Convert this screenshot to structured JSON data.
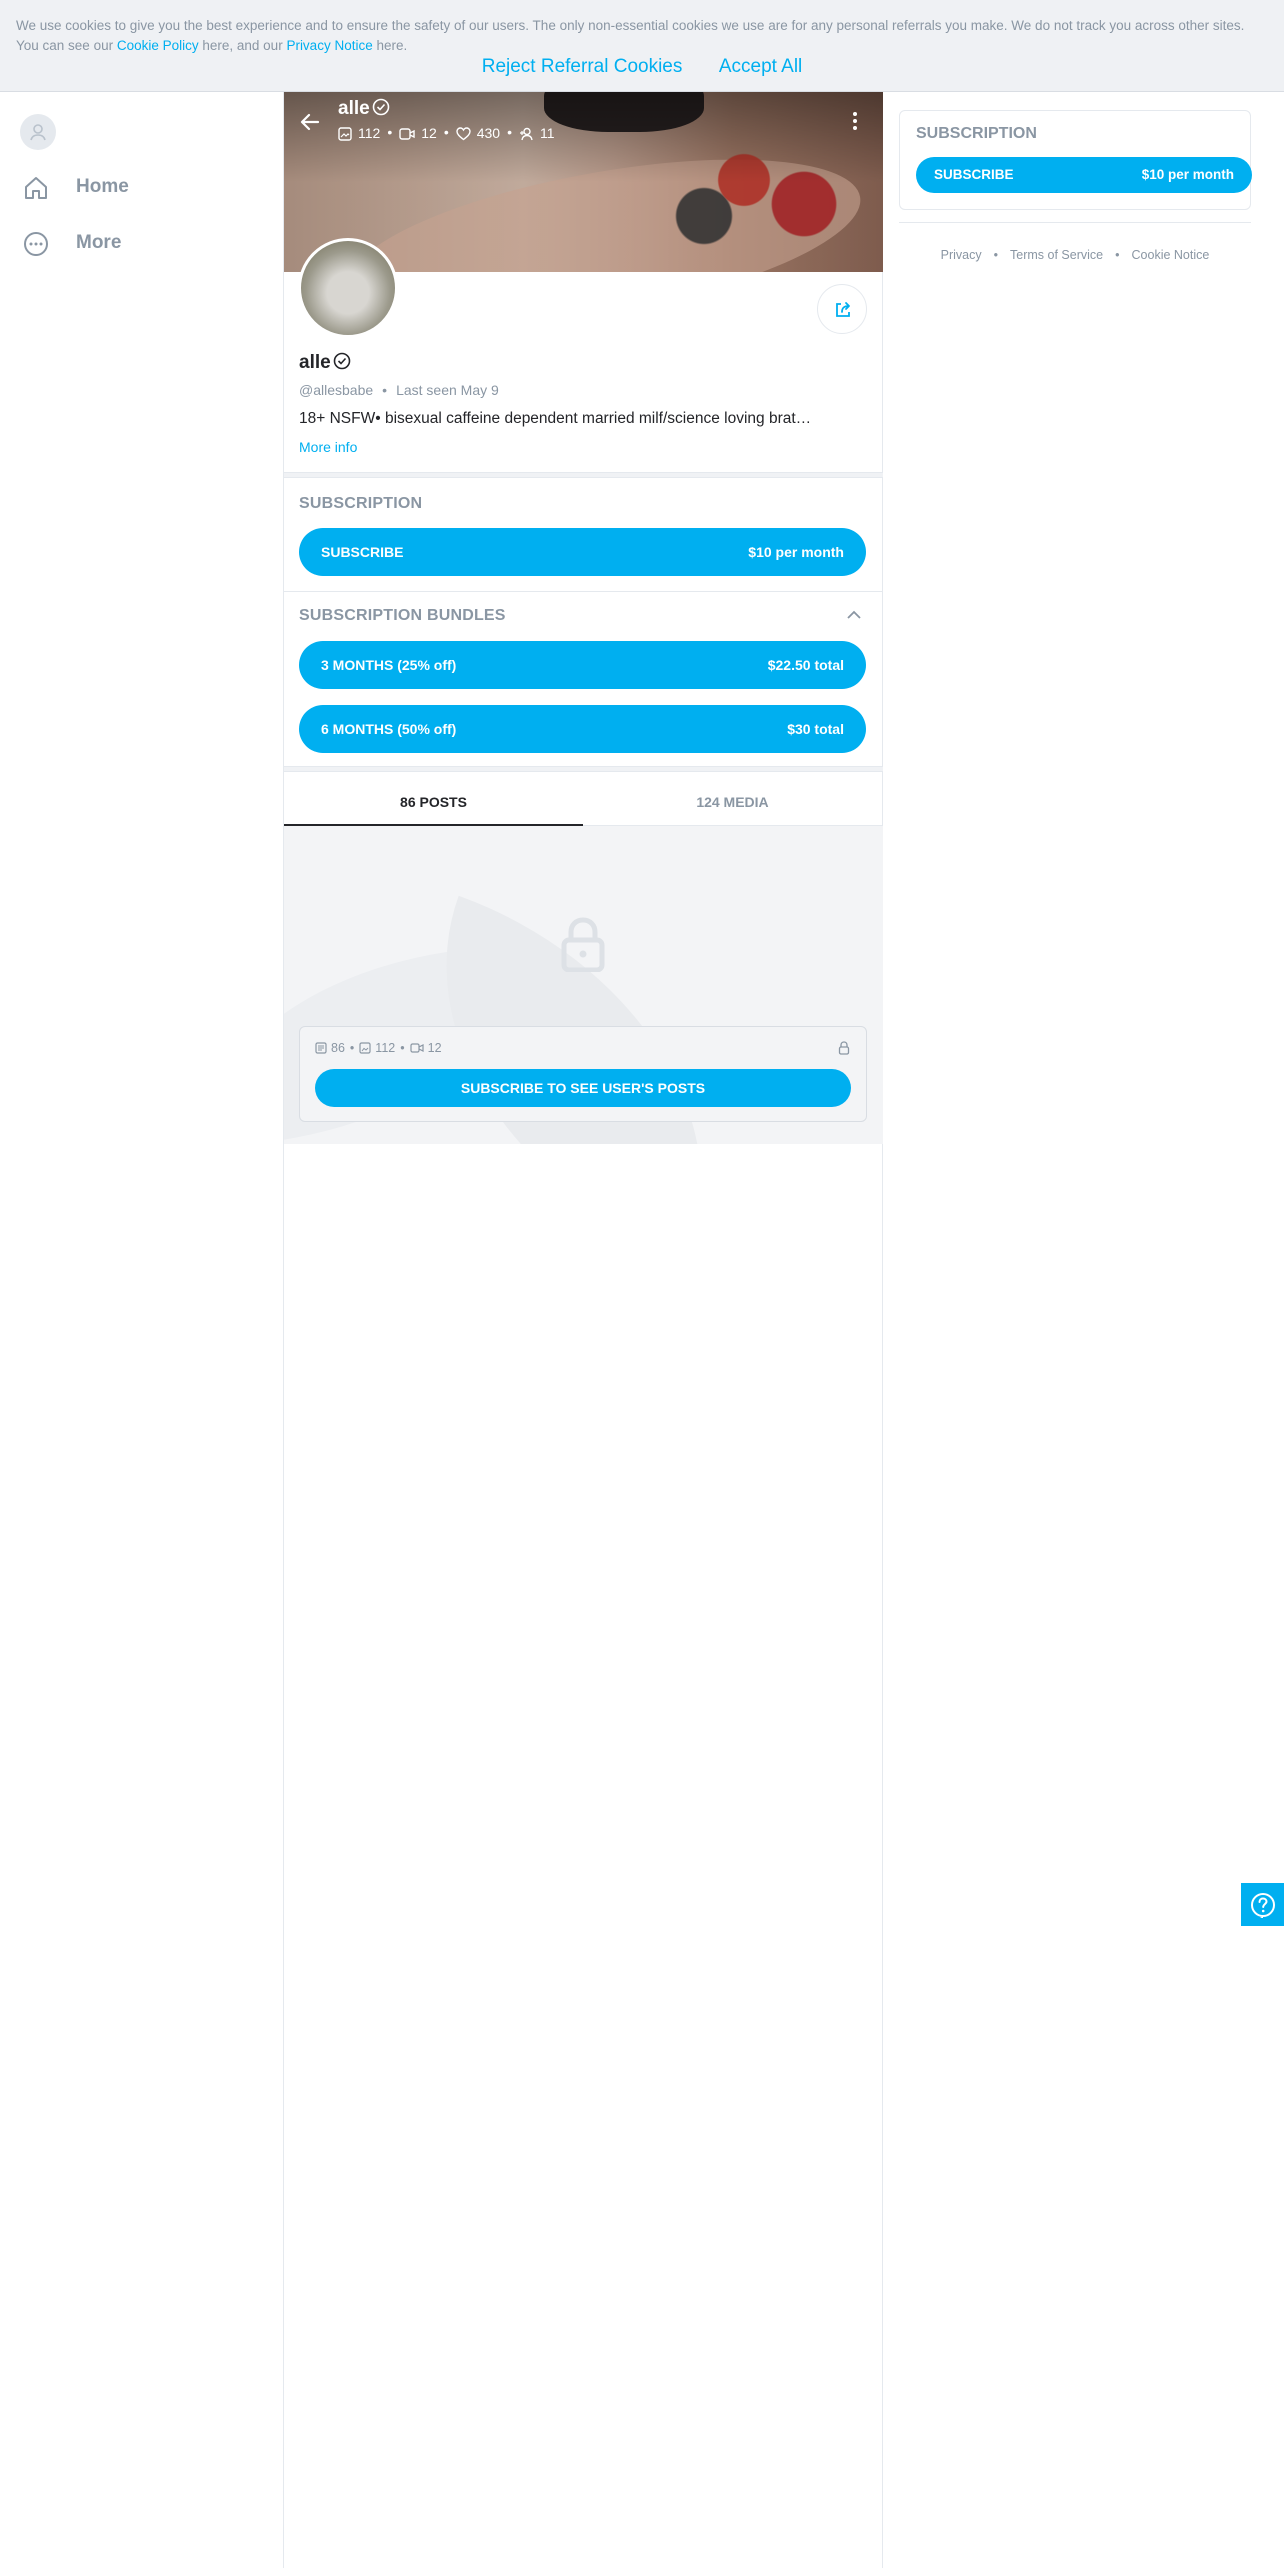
{
  "cookie_banner": {
    "text_part1": "We use cookies to give you the best experience and to ensure the safety of our users. The only non-essential cookies we use are for any personal referrals you make. We do not track you across other sites. You can see our ",
    "cookie_policy_link": "Cookie Policy",
    "text_part2": " here, and our ",
    "privacy_notice_link": "Privacy Notice",
    "text_part3": " here.",
    "reject_label": "Reject Referral Cookies",
    "accept_label": "Accept All"
  },
  "left_nav": {
    "items": [
      {
        "label": "Home",
        "icon": "home-icon"
      },
      {
        "label": "More",
        "icon": "more-icon"
      }
    ]
  },
  "profile": {
    "display_name": "alle",
    "username": "@allesbabe",
    "last_seen": "Last seen May 9",
    "bio": "18+ NSFW• bisexual caffeine dependent married milf/science loving brat…",
    "more_info_label": "More info",
    "stats": {
      "photos": "112",
      "videos": "12",
      "likes": "430",
      "subscribers": "11"
    }
  },
  "subscription": {
    "title": "SUBSCRIPTION",
    "button_label": "SUBSCRIBE",
    "price": "$10 per month"
  },
  "bundles": {
    "title": "SUBSCRIPTION BUNDLES",
    "items": [
      {
        "label": "3 MONTHS (25% off)",
        "price": "$22.50 total"
      },
      {
        "label": "6 MONTHS (50% off)",
        "price": "$30 total"
      }
    ]
  },
  "tabs": [
    {
      "label": "86 POSTS",
      "active": true
    },
    {
      "label": "124 MEDIA",
      "active": false
    }
  ],
  "locked": {
    "posts": "86",
    "photos": "112",
    "videos": "12",
    "button_label": "SUBSCRIBE TO SEE USER'S POSTS"
  },
  "right_panel": {
    "title": "SUBSCRIPTION",
    "button_label": "SUBSCRIBE",
    "price": "$10 per month",
    "footer_links": [
      "Privacy",
      "Terms of Service",
      "Cookie Notice"
    ]
  },
  "colors": {
    "accent": "#00aff0",
    "muted_text": "#8a96a3",
    "text": "#242529"
  }
}
